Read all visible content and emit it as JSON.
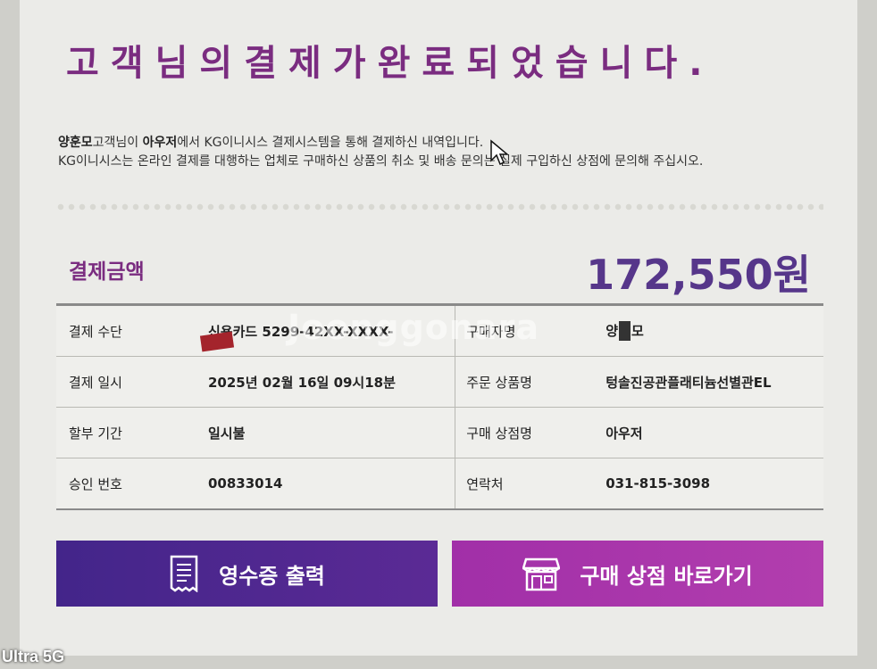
{
  "title": "고객님의결제가완료되었습니다.",
  "intro": {
    "customer_name": "양훈모",
    "line1_a": "고객님이 ",
    "store_name": "아우저",
    "line1_b": "에서 KG이니시스 결제시스템을 통해 결제하신 내역입니다.",
    "line2": "KG이니시스는 온라인 결제를 대행하는 업체로 구매하신 상품의 취소 및 배송 문의는 실제 구입하신 상점에 문의해 주십시오."
  },
  "amount": {
    "label": "결제금액",
    "value": "172,550원"
  },
  "watermark": "Joonggonara",
  "rows": [
    {
      "label": "결제 수단",
      "value": "신용카드 5299-42XX-XXXX-",
      "label2": "구매자명",
      "value2_a": "양",
      "value2_b": "모"
    },
    {
      "label": "결제 일시",
      "value": "2025년 02월 16일 09시18분",
      "label2": "주문 상품명",
      "value2": "텅솔진공관플래티늄선별관EL"
    },
    {
      "label": "할부 기간",
      "value": "일시불",
      "label2": "구매 상점명",
      "value2": "아우저"
    },
    {
      "label": "승인 번호",
      "value": "00833014",
      "label2": "연락처",
      "value2": "031-815-3098"
    }
  ],
  "buttons": {
    "receipt": "영수증 출력",
    "store": "구매 상점 바로가기"
  },
  "colors": {
    "title": "#7a2c80",
    "amount": "#56368a",
    "receipt_btn": "#4a2790",
    "store_btn": "#a935aa"
  },
  "icons": {
    "receipt": "receipt-icon",
    "store": "store-icon",
    "cursor": "mouse-cursor-icon"
  },
  "caption": "Ultra 5G"
}
